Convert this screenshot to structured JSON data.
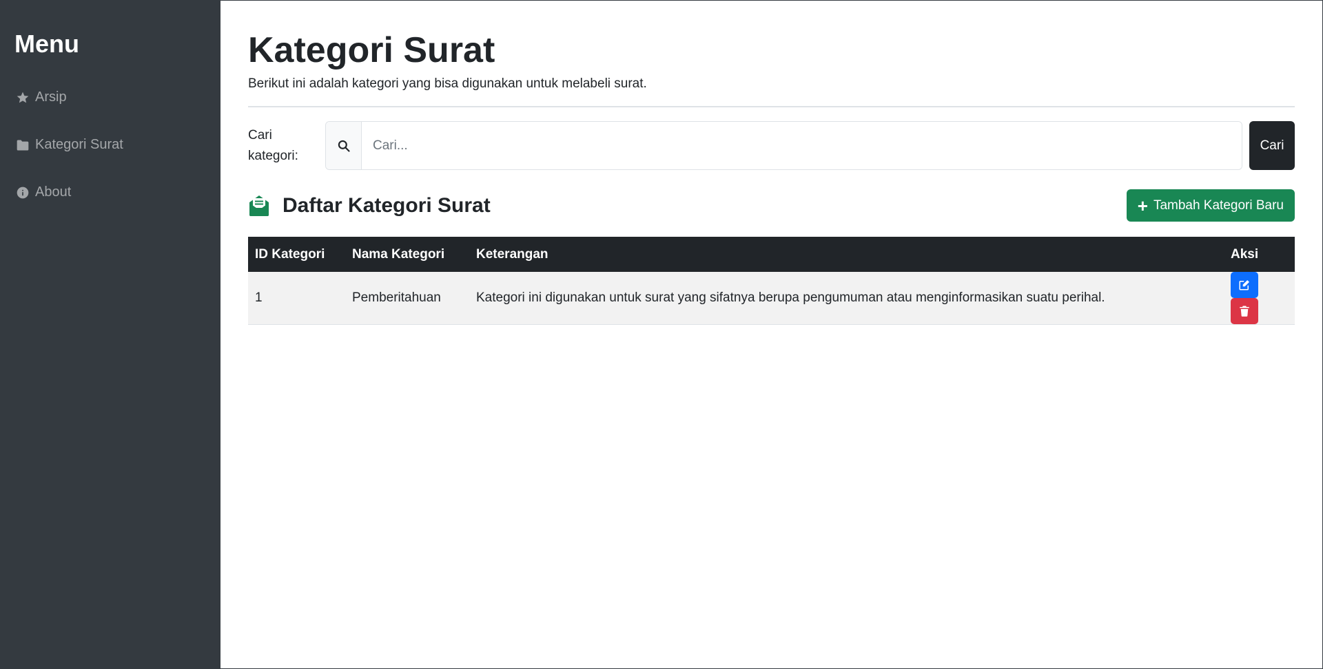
{
  "sidebar": {
    "title": "Menu",
    "items": [
      {
        "label": "Arsip",
        "icon": "star-icon"
      },
      {
        "label": "Kategori Surat",
        "icon": "folder-icon"
      },
      {
        "label": "About",
        "icon": "info-circle-icon"
      }
    ]
  },
  "header": {
    "title": "Kategori Surat",
    "subtitle": "Berikut ini adalah kategori yang bisa digunakan untuk melabeli surat."
  },
  "search": {
    "label": "Cari kategori:",
    "placeholder": "Cari...",
    "value": "",
    "button_label": "Cari"
  },
  "list": {
    "title": "Daftar Kategori Surat",
    "add_button_label": "Tambah Kategori Baru",
    "columns": [
      "ID Kategori",
      "Nama Kategori",
      "Keterangan",
      "Aksi"
    ],
    "rows": [
      {
        "id": "1",
        "nama": "Pemberitahuan",
        "keterangan": "Kategori ini digunakan untuk surat yang sifatnya berupa pengumuman atau menginformasikan suatu perihal."
      }
    ]
  },
  "colors": {
    "sidebar_bg": "#343a40",
    "dark": "#212529",
    "success": "#198754",
    "primary": "#0d6efd",
    "danger": "#dc3545"
  }
}
